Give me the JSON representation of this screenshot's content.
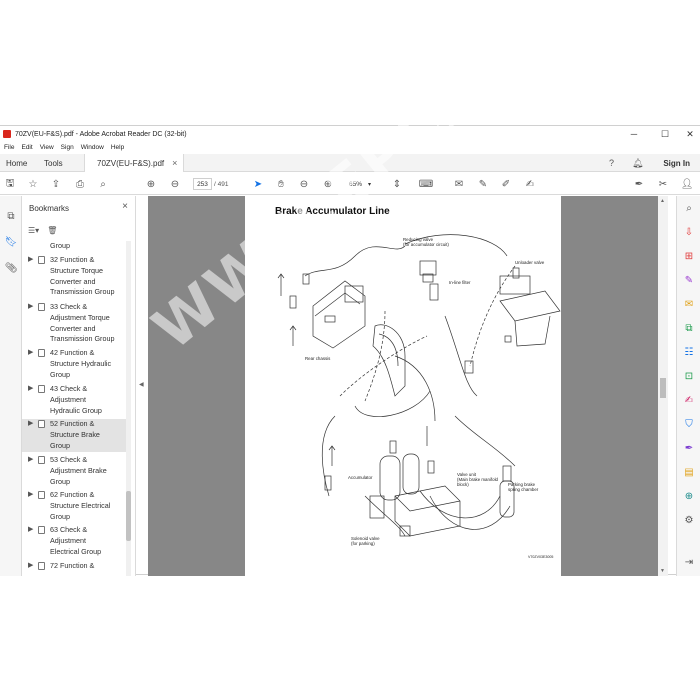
{
  "window": {
    "title": "70ZV(EU-F&S).pdf - Adobe Acrobat Reader DC (32-bit)",
    "minimize": "─",
    "maximize": "☐",
    "close": "✕"
  },
  "menu": [
    "File",
    "Edit",
    "View",
    "Sign",
    "Window",
    "Help"
  ],
  "tabs": {
    "home": "Home",
    "tools": "Tools",
    "doc": "70ZV(EU-F&S).pdf",
    "doc_close": "×",
    "signin": "Sign In"
  },
  "toolbar": {
    "page_current": "253",
    "page_total": "/ 491",
    "zoom": "65%"
  },
  "bookmarks": {
    "title": "Bookmarks",
    "close": "×",
    "items": [
      {
        "label": "Group",
        "partial": true
      },
      {
        "label": "32 Function &\nStructure Torque\nConverter and\nTransmission Group"
      },
      {
        "label": "33 Check &\nAdjustment Torque\nConverter and\nTransmission Group"
      },
      {
        "label": "42 Function &\nStructure Hydraulic\nGroup"
      },
      {
        "label": "43 Check &\nAdjustment\nHydraulic Group"
      },
      {
        "label": "52 Function &\nStructure Brake\nGroup",
        "selected": true
      },
      {
        "label": "53 Check &\nAdjustment Brake\nGroup"
      },
      {
        "label": "62 Function &\nStructure Electrical\nGroup"
      },
      {
        "label": "63 Check &\nAdjustment\nElectrical Group"
      },
      {
        "label": "72 Function &",
        "partial": true
      }
    ]
  },
  "page": {
    "title": "Brake Accumulator Line",
    "labels": {
      "reducing_valve": "Reducing valve",
      "reducing_valve_sub": "(for accumulator circuit)",
      "unloader_valve": "Unloader valve",
      "inline_filter": "In-line filter",
      "rear_chassis": "Rear chassis",
      "accumulator": "Accumulator",
      "valve_unit": "Valve unit",
      "valve_unit_sub1": "(Main brake manifold",
      "valve_unit_sub2": "block)",
      "parking_brake": "Parking brake",
      "parking_brake_sub": "spring chamber",
      "solenoid_valve": "Solenoid valve",
      "solenoid_valve_sub": "(for parking)",
      "figure_code": "V70ZV03E3005"
    }
  },
  "watermark": "WWW.EPCATALOGS.COM",
  "colors": {
    "accent_red": "#d9271d",
    "accent_blue": "#1473e6",
    "doc_background": "#878787"
  }
}
